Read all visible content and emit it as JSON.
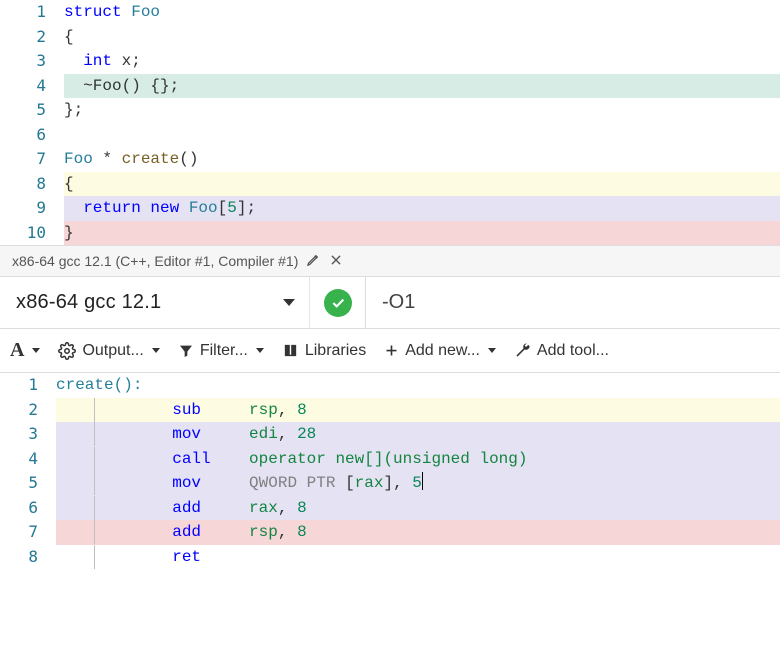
{
  "source": {
    "lines": [
      {
        "n": 1,
        "hl": "hl-none",
        "tokens": [
          {
            "t": "struct ",
            "c": "kw"
          },
          {
            "t": "Foo",
            "c": "type"
          }
        ]
      },
      {
        "n": 2,
        "hl": "hl-none",
        "tokens": [
          {
            "t": "{",
            "c": "op"
          }
        ]
      },
      {
        "n": 3,
        "hl": "hl-none",
        "indent": "  ",
        "tokens": [
          {
            "t": "int",
            "c": "kw"
          },
          {
            "t": " x;",
            "c": "op"
          }
        ]
      },
      {
        "n": 4,
        "hl": "hl-teal",
        "indent": "  ",
        "tokens": [
          {
            "t": "~Foo() {};",
            "c": "op"
          }
        ]
      },
      {
        "n": 5,
        "hl": "hl-none",
        "tokens": [
          {
            "t": "};",
            "c": "op"
          }
        ]
      },
      {
        "n": 6,
        "hl": "hl-none",
        "tokens": []
      },
      {
        "n": 7,
        "hl": "hl-none",
        "tokens": [
          {
            "t": "Foo",
            "c": "type"
          },
          {
            "t": " * ",
            "c": "op"
          },
          {
            "t": "create",
            "c": "func"
          },
          {
            "t": "()",
            "c": "op"
          }
        ]
      },
      {
        "n": 8,
        "hl": "hl-yellow",
        "tokens": [
          {
            "t": "{",
            "c": "op"
          }
        ]
      },
      {
        "n": 9,
        "hl": "hl-lav",
        "indent": "  ",
        "tokens": [
          {
            "t": "return ",
            "c": "kw"
          },
          {
            "t": "new ",
            "c": "kw"
          },
          {
            "t": "Foo",
            "c": "type"
          },
          {
            "t": "[",
            "c": "op"
          },
          {
            "t": "5",
            "c": "num"
          },
          {
            "t": "];",
            "c": "op"
          }
        ]
      },
      {
        "n": 10,
        "hl": "hl-pink",
        "tokens": [
          {
            "t": "}",
            "c": "op"
          }
        ]
      }
    ]
  },
  "tab": {
    "label": "x86-64 gcc 12.1 (C++, Editor #1, Compiler #1)"
  },
  "compiler": {
    "name": "x86-64 gcc 12.1",
    "status": "ok",
    "options": "-O1"
  },
  "toolbar": {
    "font_label": "A",
    "output_label": "Output...",
    "filter_label": "Filter...",
    "libraries_label": "Libraries",
    "add_new_label": "Add new...",
    "add_tool_label": "Add tool..."
  },
  "asm": {
    "lines": [
      {
        "n": 1,
        "hl": "hl-none",
        "bar": false,
        "label": true,
        "tokens": [
          {
            "t": "create():",
            "c": "asm-lbl"
          }
        ]
      },
      {
        "n": 2,
        "hl": "hl-yellow",
        "bar": true,
        "tokens": [
          {
            "t": "        ",
            "c": ""
          },
          {
            "t": "sub",
            "c": "asm-mn"
          },
          {
            "t": "     ",
            "c": ""
          },
          {
            "t": "rsp",
            "c": "asm-reg"
          },
          {
            "t": ", ",
            "c": ""
          },
          {
            "t": "8",
            "c": "num"
          }
        ]
      },
      {
        "n": 3,
        "hl": "hl-lav",
        "bar": true,
        "tokens": [
          {
            "t": "        ",
            "c": ""
          },
          {
            "t": "mov",
            "c": "asm-mn"
          },
          {
            "t": "     ",
            "c": ""
          },
          {
            "t": "edi",
            "c": "asm-reg"
          },
          {
            "t": ", ",
            "c": ""
          },
          {
            "t": "28",
            "c": "num"
          }
        ]
      },
      {
        "n": 4,
        "hl": "hl-lav",
        "bar": true,
        "tokens": [
          {
            "t": "        ",
            "c": ""
          },
          {
            "t": "call",
            "c": "asm-mn"
          },
          {
            "t": "    ",
            "c": ""
          },
          {
            "t": "operator new[](unsigned long)",
            "c": "asm-reg"
          }
        ]
      },
      {
        "n": 5,
        "hl": "hl-lav",
        "bar": true,
        "cursor": true,
        "tokens": [
          {
            "t": "        ",
            "c": ""
          },
          {
            "t": "mov",
            "c": "asm-mn"
          },
          {
            "t": "     ",
            "c": ""
          },
          {
            "t": "QWORD PTR ",
            "c": "asm-dim"
          },
          {
            "t": "[",
            "c": ""
          },
          {
            "t": "rax",
            "c": "asm-reg"
          },
          {
            "t": "], ",
            "c": ""
          },
          {
            "t": "5",
            "c": "num"
          }
        ]
      },
      {
        "n": 6,
        "hl": "hl-lav",
        "bar": true,
        "tokens": [
          {
            "t": "        ",
            "c": ""
          },
          {
            "t": "add",
            "c": "asm-mn"
          },
          {
            "t": "     ",
            "c": ""
          },
          {
            "t": "rax",
            "c": "asm-reg"
          },
          {
            "t": ", ",
            "c": ""
          },
          {
            "t": "8",
            "c": "num"
          }
        ]
      },
      {
        "n": 7,
        "hl": "hl-pink",
        "bar": true,
        "tokens": [
          {
            "t": "        ",
            "c": ""
          },
          {
            "t": "add",
            "c": "asm-mn"
          },
          {
            "t": "     ",
            "c": ""
          },
          {
            "t": "rsp",
            "c": "asm-reg"
          },
          {
            "t": ", ",
            "c": ""
          },
          {
            "t": "8",
            "c": "num"
          }
        ]
      },
      {
        "n": 8,
        "hl": "hl-none",
        "bar": true,
        "tokens": [
          {
            "t": "        ",
            "c": ""
          },
          {
            "t": "ret",
            "c": "asm-mn"
          }
        ]
      }
    ]
  },
  "chart_data": null
}
